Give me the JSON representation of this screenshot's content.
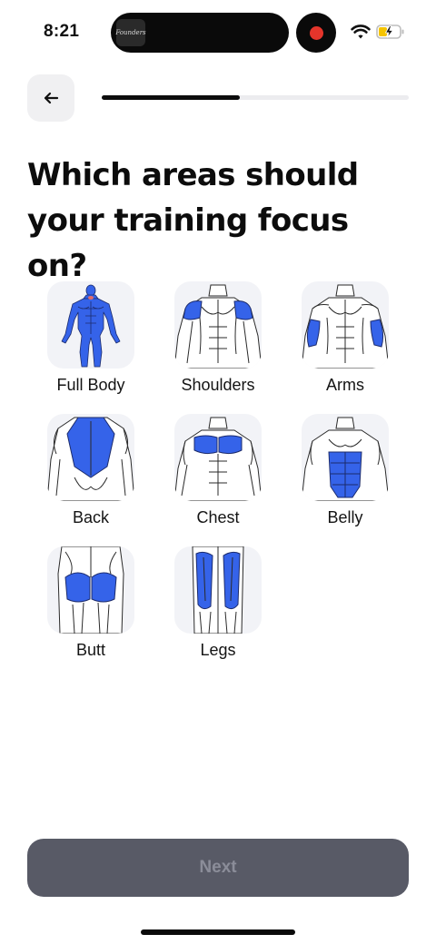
{
  "status_bar": {
    "time": "8:21",
    "island_thumb_text": "Founders",
    "record_icon": "record-dot",
    "wifi_icon": "wifi-icon",
    "battery_icon": "battery-charging-icon",
    "battery_color": "#f5c400"
  },
  "header": {
    "back_icon": "arrow-left-icon",
    "progress_fraction": 0.45
  },
  "title": "Which areas should your training focus on?",
  "areas": [
    {
      "label": "Full Body",
      "icon": "full-body-icon"
    },
    {
      "label": "Shoulders",
      "icon": "shoulders-icon"
    },
    {
      "label": "Arms",
      "icon": "arms-icon"
    },
    {
      "label": "Back",
      "icon": "back-icon"
    },
    {
      "label": "Chest",
      "icon": "chest-icon"
    },
    {
      "label": "Belly",
      "icon": "belly-icon"
    },
    {
      "label": "Butt",
      "icon": "butt-icon"
    },
    {
      "label": "Legs",
      "icon": "legs-icon"
    }
  ],
  "next_button": {
    "label": "Next",
    "enabled": false
  },
  "colors": {
    "highlight": "#3563e9",
    "tile_bg": "#f2f3f7",
    "button_disabled_bg": "#585a66",
    "button_disabled_text": "#8b8d99"
  }
}
